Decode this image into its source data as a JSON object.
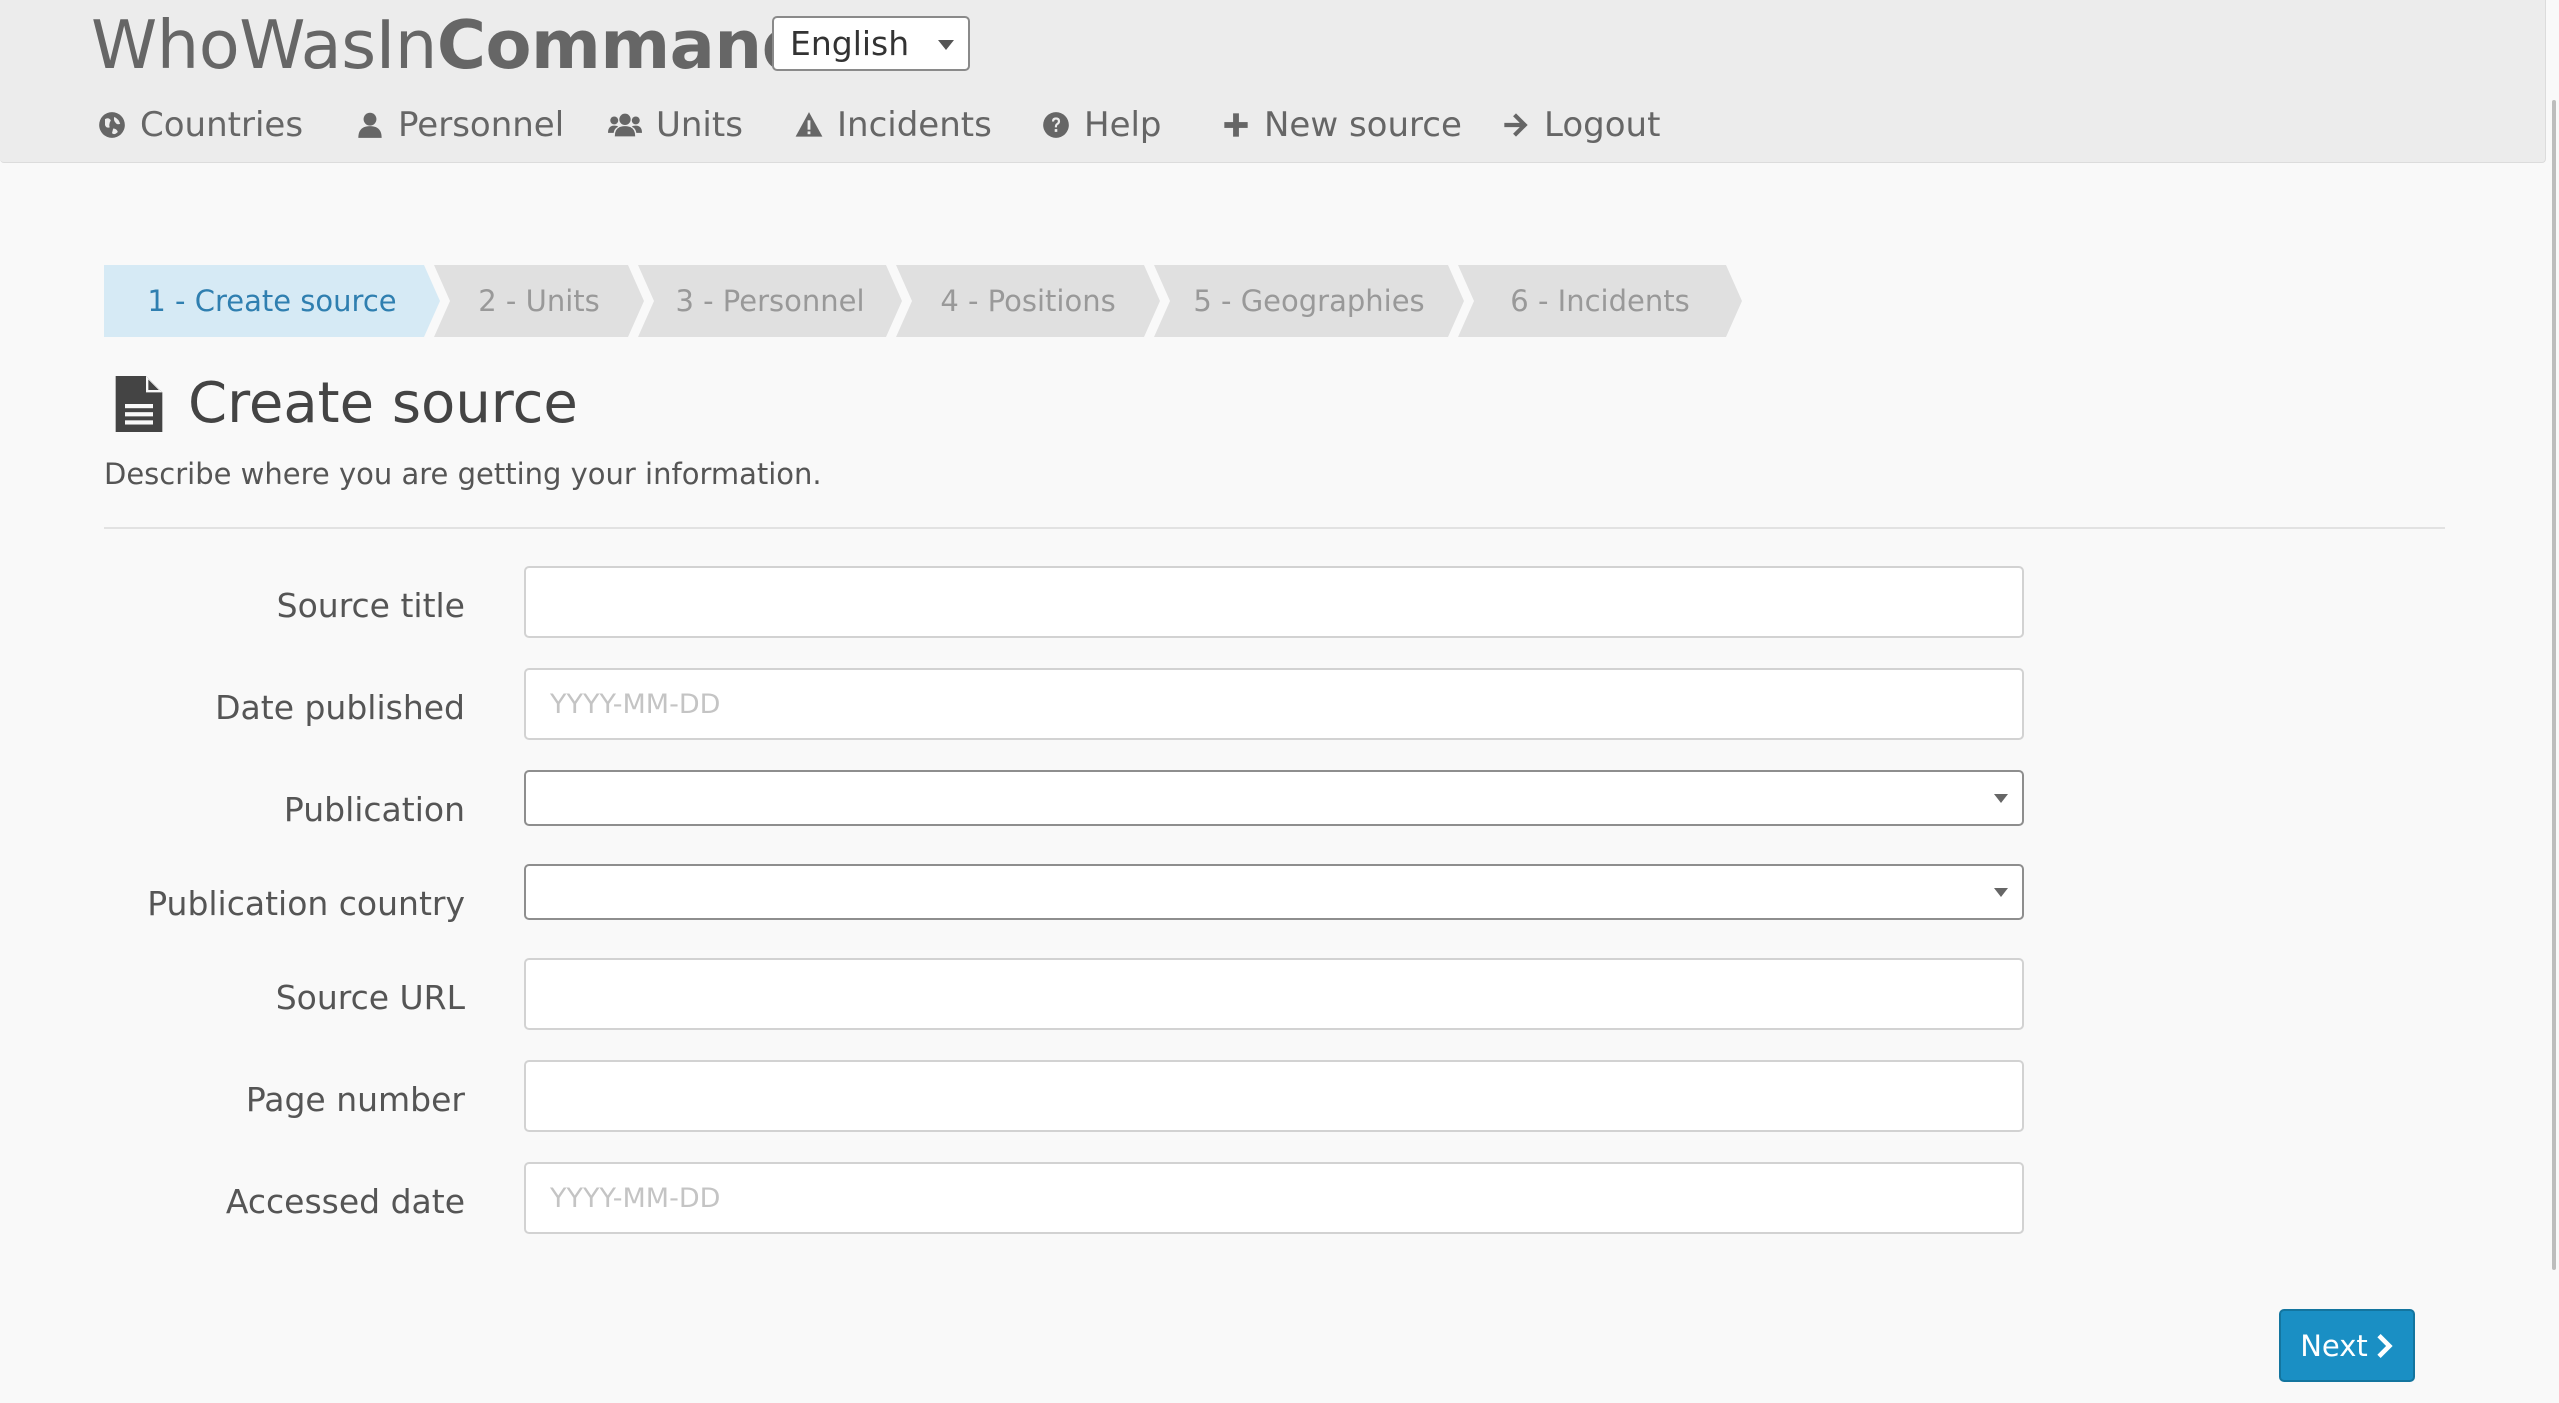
{
  "brand": {
    "light": "WhoWasIn",
    "bold": "Command"
  },
  "language": {
    "selected": "English"
  },
  "nav": [
    {
      "label": "Countries",
      "icon": "globe-icon"
    },
    {
      "label": "Personnel",
      "icon": "user-icon"
    },
    {
      "label": "Units",
      "icon": "users-icon"
    },
    {
      "label": "Incidents",
      "icon": "warning-icon"
    },
    {
      "label": "Help",
      "icon": "question-circle-icon"
    },
    {
      "label": "New source",
      "icon": "plus-icon"
    },
    {
      "label": "Logout",
      "icon": "arrow-right-icon"
    }
  ],
  "steps": [
    {
      "label": "1 - Create source",
      "active": true
    },
    {
      "label": "2 - Units",
      "active": false
    },
    {
      "label": "3 - Personnel",
      "active": false
    },
    {
      "label": "4 - Positions",
      "active": false
    },
    {
      "label": "5 - Geographies",
      "active": false
    },
    {
      "label": "6 - Incidents",
      "active": false
    }
  ],
  "page": {
    "title": "Create source",
    "subtitle": "Describe where you are getting your information.",
    "icon": "file-text-icon"
  },
  "form": {
    "source_title": {
      "label": "Source title",
      "value": "",
      "placeholder": ""
    },
    "date_published": {
      "label": "Date published",
      "value": "",
      "placeholder": "YYYY-MM-DD"
    },
    "publication": {
      "label": "Publication",
      "value": ""
    },
    "publication_country": {
      "label": "Publication country",
      "value": ""
    },
    "source_url": {
      "label": "Source URL",
      "value": "",
      "placeholder": ""
    },
    "page_number": {
      "label": "Page number",
      "value": "",
      "placeholder": ""
    },
    "accessed_date": {
      "label": "Accessed date",
      "value": "",
      "placeholder": "YYYY-MM-DD"
    }
  },
  "actions": {
    "next_label": "Next"
  },
  "colors": {
    "accent": "#1a8fc4",
    "active_step_bg": "#d6eaf5",
    "active_step_text": "#2f7fb0",
    "navbar_bg": "#ececec"
  }
}
